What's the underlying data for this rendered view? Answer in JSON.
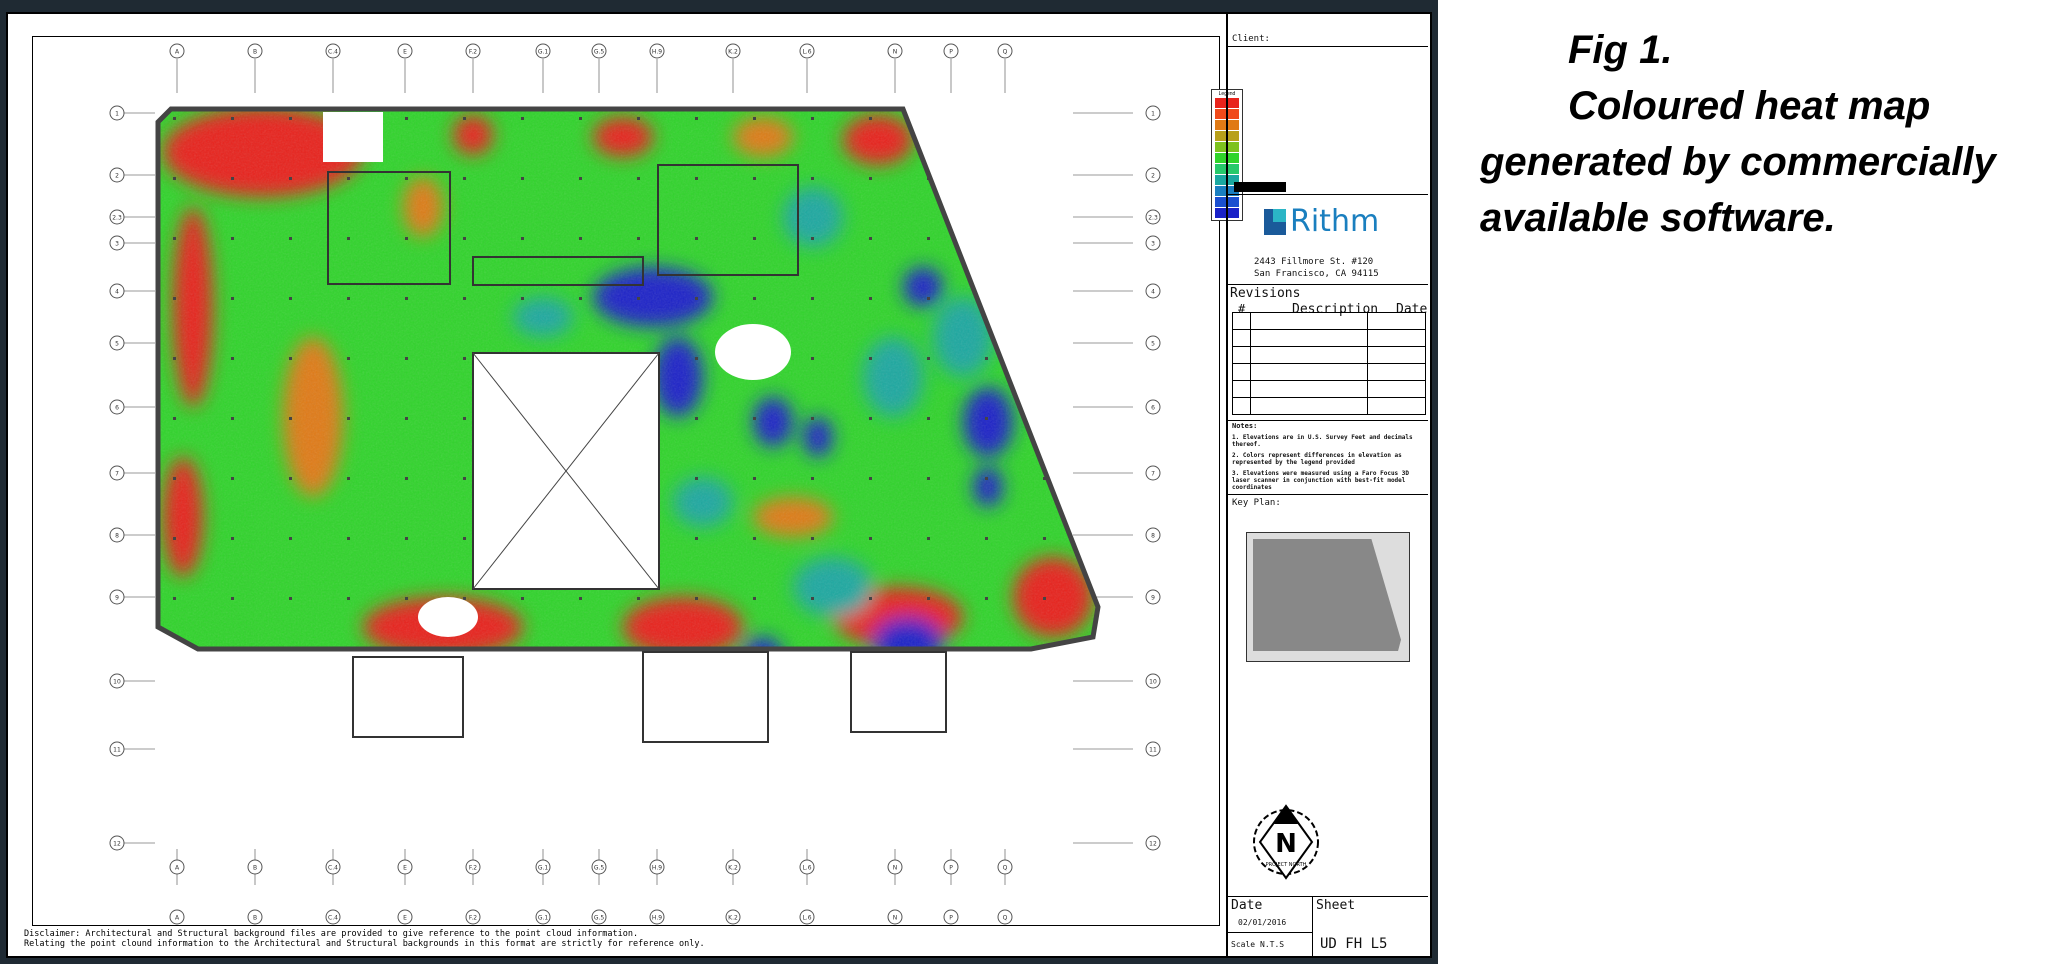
{
  "title_block": {
    "client_label": "Client:",
    "company_name": "Rithm",
    "address_line1": "2443 Fillmore St. #120",
    "address_line2": "San Francisco, CA 94115",
    "revisions_label": "Revisions",
    "rev_col_num": "#",
    "rev_col_desc": "Description",
    "rev_col_date": "Date",
    "notes_label": "Notes:",
    "note1": "1. Elevations are in U.S. Survey Feet and decimals thereof.",
    "note2": "2. Colors represent differences in elevation as represented by the legend provided",
    "note3": "3. Elevations were measured using a Faro Focus 3D laser scanner in conjunction with best-fit model coordinates",
    "key_plan_label": "Key Plan:",
    "north_label": "N",
    "north_caption": "PROJECT NORTH",
    "date_label": "Date",
    "date_value": "02/01/2016",
    "sheet_label": "Sheet",
    "scale_label": "Scale",
    "scale_value": "N.T.S",
    "sheet_value": "UD FH L5"
  },
  "legend": {
    "title": "Legend",
    "colors": [
      "#e8231c",
      "#f04a1a",
      "#e07a15",
      "#b8a01a",
      "#7dc21e",
      "#2fd42a",
      "#26c96a",
      "#1aa8a0",
      "#1a7fc0",
      "#1a4fd0",
      "#1a22c8"
    ]
  },
  "grid_columns_top": [
    "A",
    "B",
    "C.4",
    "E",
    "F.2",
    "G.1",
    "G.5",
    "H.9",
    "K.2",
    "L.6",
    "N",
    "P",
    "Q"
  ],
  "grid_rows_left": [
    "1",
    "2",
    "2.3",
    "3",
    "4",
    "5",
    "6",
    "7",
    "8",
    "9",
    "10",
    "11",
    "12"
  ],
  "disclaimer_line1": "Disclaimer: Architectural and Structural background files are provided to give reference to the point cloud information.",
  "disclaimer_line2": "Relating the point clound information to the Architectural and Structural backgrounds in this format are strictly for reference only.",
  "caption": {
    "line1": "Fig 1.",
    "line2": "Coloured heat map",
    "line3": "generated by commercially",
    "line4": "available software."
  },
  "colors": {
    "red": "#e8231c",
    "green": "#2fd42a",
    "blue": "#1a22c8",
    "orange": "#e07a15",
    "teal": "#1aa8a0"
  }
}
